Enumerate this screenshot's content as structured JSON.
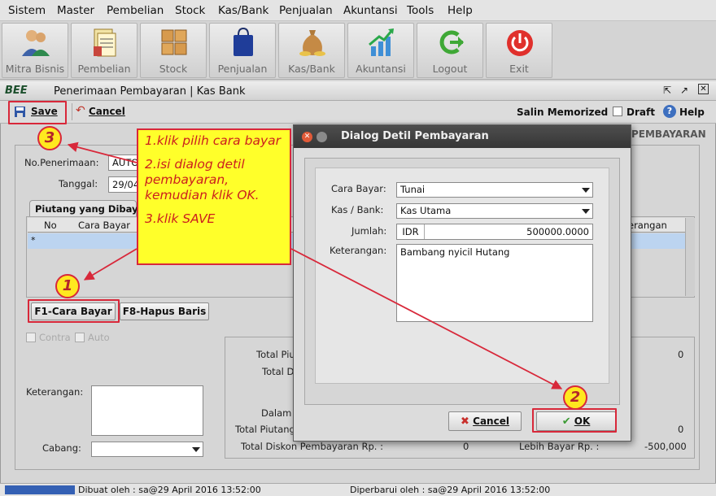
{
  "menu": [
    "Sistem",
    "Master",
    "Pembelian",
    "Stock",
    "Kas/Bank",
    "Penjualan",
    "Akuntansi",
    "Tools",
    "Help"
  ],
  "toolbar": [
    {
      "label": "Mitra Bisnis",
      "icon": "people-icon"
    },
    {
      "label": "Pembelian",
      "icon": "purchase-icon"
    },
    {
      "label": "Stock",
      "icon": "boxes-icon"
    },
    {
      "label": "Penjualan",
      "icon": "shopping-bag-icon"
    },
    {
      "label": "Kas/Bank",
      "icon": "money-bag-icon"
    },
    {
      "label": "Akuntansi",
      "icon": "chart-up-icon"
    },
    {
      "label": "Logout",
      "icon": "logout-icon"
    },
    {
      "label": "Exit",
      "icon": "power-icon"
    }
  ],
  "window": {
    "logo": "BEE",
    "title": "Penerimaan Pembayaran | Kas Bank",
    "save": "Save",
    "cancel": "Cancel",
    "salin": "Salin Memorized",
    "draft": "Draft",
    "help": "Help",
    "section_right": "PEMBAYARAN"
  },
  "form": {
    "no_label": "No.Penerimaan:",
    "no_value": "AUTO",
    "tanggal_label": "Tanggal:",
    "tanggal_value": "29/04",
    "tab": "Piutang yang Dibay",
    "col_no": "No",
    "col_cara": "Cara Bayar",
    "col_ket": "erangan",
    "row_marker": "*",
    "btn_f1": "F1-Cara Bayar",
    "btn_f8": "F8-Hapus Baris",
    "contra": "Contra",
    "auto": "Auto",
    "keterangan": "Keterangan:",
    "cabang": "Cabang:"
  },
  "totals": {
    "total_piu": "Total Piu",
    "total_d": "Total D",
    "dalam": "Dalam",
    "total_piutang": "Total Piutang",
    "total_diskon": "Total Diskon Pembayaran Rp. :",
    "total_diskon_val": "0",
    "lebih_bayar": "Lebih Bayar Rp. :",
    "lebih_bayar_val": "-500,000",
    "val_0a": "0",
    "val_0b": "0"
  },
  "note": {
    "line1": "1.klik pilih cara bayar",
    "line2": "2.isi dialog detil pembayaran, kemudian klik OK.",
    "line3": "3.klik SAVE"
  },
  "badges": {
    "one": "1",
    "two": "2",
    "three": "3"
  },
  "dialog": {
    "title": "Dialog Detil Pembayaran",
    "cara_label": "Cara Bayar:",
    "cara_value": "Tunai",
    "kas_label": "Kas / Bank:",
    "kas_value": "Kas Utama",
    "jumlah_label": "Jumlah:",
    "currency": "IDR",
    "amount": "500000.0000",
    "ket_label": "Keterangan:",
    "ket_value": "Bambang nyicil Hutang",
    "cancel": "Cancel",
    "ok": "OK"
  },
  "status": {
    "dibuat": "Dibuat oleh : sa@29 April 2016  13:52:00",
    "diperbarui": "Diperbarui oleh : sa@29 April 2016  13:52:00"
  },
  "colors": {
    "accent_red": "#d8283a",
    "note_yellow": "#ffff2a",
    "dialog_title": "#3c3c3c"
  }
}
